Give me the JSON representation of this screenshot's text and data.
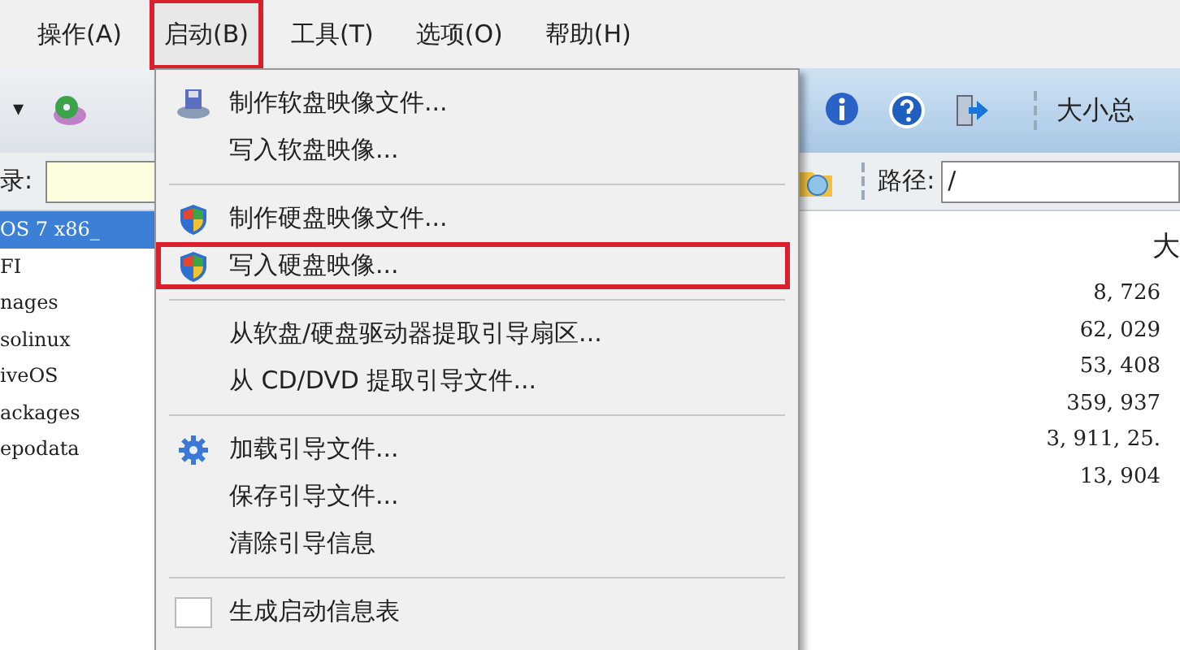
{
  "menubar": [
    {
      "label": "操作(A)",
      "highlighted": false
    },
    {
      "label": "启动(B)",
      "highlighted": true
    },
    {
      "label": "工具(T)",
      "highlighted": false
    },
    {
      "label": "选项(O)",
      "highlighted": false
    },
    {
      "label": "帮助(H)",
      "highlighted": false
    }
  ],
  "toolbar": {
    "dropdown": "▾",
    "summary_label": "大小总"
  },
  "address": {
    "label": "录:"
  },
  "path": {
    "label": "路径:",
    "value": "/"
  },
  "tree": [
    {
      "label": "OS 7 x86_",
      "selected": true
    },
    {
      "label": "FI",
      "selected": false
    },
    {
      "label": "nages",
      "selected": false
    },
    {
      "label": "solinux",
      "selected": false
    },
    {
      "label": "iveOS",
      "selected": false
    },
    {
      "label": "ackages",
      "selected": false
    },
    {
      "label": "epodata",
      "selected": false
    }
  ],
  "file_list": {
    "column_header": "大",
    "sizes": [
      "8, 726",
      "62, 029",
      "53, 408",
      "359, 937",
      "3, 911, 25.",
      "13, 904"
    ]
  },
  "menu": [
    {
      "kind": "floppy",
      "label": "制作软盘映像文件...",
      "highlighted": false
    },
    {
      "kind": "plain",
      "label": "写入软盘映像...",
      "highlighted": false
    },
    {
      "kind": "separator"
    },
    {
      "kind": "shield",
      "label": "制作硬盘映像文件...",
      "highlighted": false
    },
    {
      "kind": "shield",
      "label": "写入硬盘映像...",
      "highlighted": true
    },
    {
      "kind": "separator"
    },
    {
      "kind": "plain",
      "label": "从软盘/硬盘驱动器提取引导扇区...",
      "highlighted": false
    },
    {
      "kind": "plain",
      "label": "从 CD/DVD 提取引导文件...",
      "highlighted": false
    },
    {
      "kind": "separator"
    },
    {
      "kind": "gear",
      "label": "加载引导文件...",
      "highlighted": false
    },
    {
      "kind": "plain",
      "label": "保存引导文件...",
      "highlighted": false
    },
    {
      "kind": "plain",
      "label": "清除引导信息",
      "highlighted": false
    },
    {
      "kind": "separator"
    },
    {
      "kind": "check",
      "label": "生成启动信息表",
      "highlighted": false
    }
  ]
}
